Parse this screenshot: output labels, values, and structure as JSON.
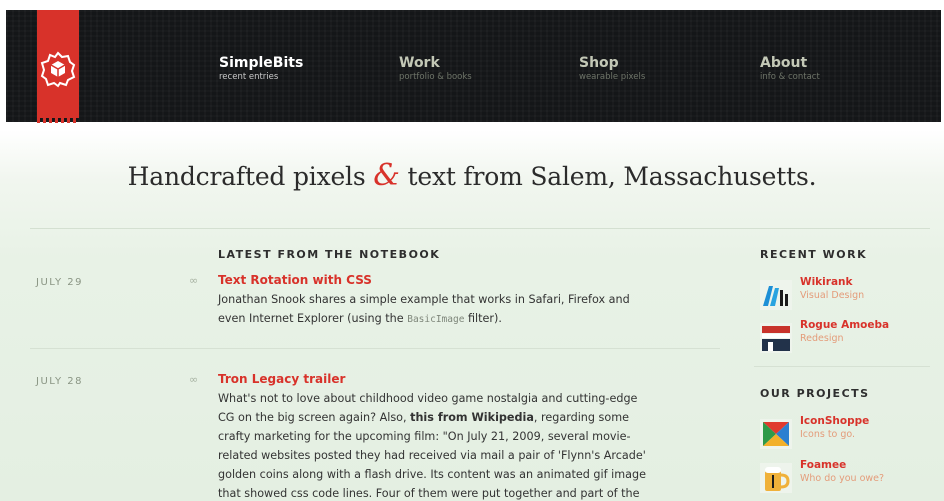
{
  "nav": {
    "items": [
      {
        "title": "SimpleBits",
        "subtitle": "recent entries"
      },
      {
        "title": "Work",
        "subtitle": "portfolio & books"
      },
      {
        "title": "Shop",
        "subtitle": "wearable pixels"
      },
      {
        "title": "About",
        "subtitle": "info & contact"
      }
    ]
  },
  "tagline": {
    "before": "Handcrafted pixels ",
    "amp": "&",
    "after": " text from Salem, Massachusetts."
  },
  "notebook": {
    "heading": "LATEST FROM THE NOTEBOOK",
    "entries": [
      {
        "date": "JULY 29",
        "link_glyph": "∞",
        "title": "Text Rotation with CSS",
        "text_1": "Jonathan Snook shares a simple example that works in Safari, Firefox and",
        "text_2a": "even Internet Explorer (using the ",
        "code": "BasicImage",
        "text_2b": " filter)."
      },
      {
        "date": "JULY 28",
        "link_glyph": "∞",
        "title": "Tron Legacy trailer",
        "line_1": "What's not to love about childhood video game nostalgia and cutting-edge",
        "line_2a": "CG on the big screen again? Also, ",
        "line_2_strong": "this from Wikipedia",
        "line_2b": ", regarding some",
        "line_3": "crafty marketing for the upcoming film: \"On July 21, 2009, several movie-",
        "line_4": "related websites posted they had received via mail a pair of 'Flynn's Arcade'",
        "line_5": "golden coins along with a flash drive. Its content was an animated gif image",
        "line_6": "that showed css code lines. Four of them were put together and part of the"
      }
    ]
  },
  "recent_work": {
    "heading": "RECENT WORK",
    "items": [
      {
        "title": "Wikirank",
        "subtitle": "Visual Design",
        "icon": "wikirank-logo"
      },
      {
        "title": "Rogue Amoeba",
        "subtitle": "Redesign",
        "icon": "rogue-amoeba-logo"
      }
    ]
  },
  "our_projects": {
    "heading": "OUR PROJECTS",
    "items": [
      {
        "title": "IconShoppe",
        "subtitle": "Icons to go.",
        "icon": "iconshoppe-logo"
      },
      {
        "title": "Foamee",
        "subtitle": "Who do you owe?",
        "icon": "foamee-logo"
      }
    ]
  },
  "colors": {
    "accent": "#d8322a",
    "header_bg": "#141618",
    "page_tint": "#e8f2e6"
  }
}
